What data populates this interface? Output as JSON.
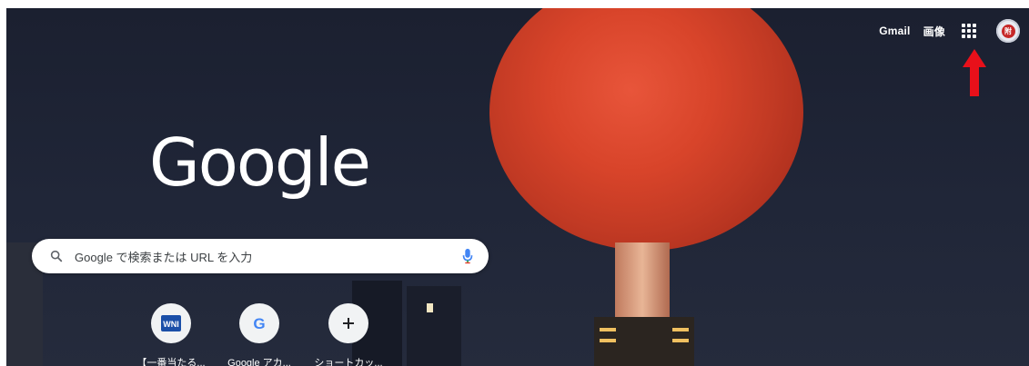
{
  "header": {
    "gmail_label": "Gmail",
    "images_label": "画像",
    "apps_icon": "apps-grid-icon",
    "avatar_text": "附"
  },
  "logo": {
    "text": "Google"
  },
  "search": {
    "placeholder": "Google で検索または URL を入力"
  },
  "shortcuts": [
    {
      "label": "【一番当たる...",
      "icon": "wni-icon"
    },
    {
      "label": "Google アカ...",
      "icon": "google-g-icon"
    },
    {
      "label": "ショートカッ...",
      "icon": "plus-icon"
    }
  ],
  "colors": {
    "background": "#1b2030",
    "moon": "#d8442a",
    "arrow": "#e8101a",
    "mic": "#4285f4"
  }
}
